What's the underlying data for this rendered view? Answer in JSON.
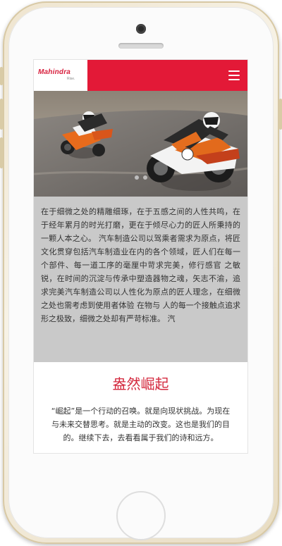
{
  "brand": {
    "name": "Mahindra",
    "sub": "Rise.",
    "accent": "#e31937",
    "title_color": "#d42a3f"
  },
  "header": {
    "menu_icon": "hamburger-menu-icon"
  },
  "hero": {
    "image": "motorcycle-racers-on-track",
    "slides": 2,
    "active_slide": 1
  },
  "intro": {
    "text": "在于细微之处的精雕细琢，在于五感之间的人性共鸣，在于经年累月的时光打磨，更在于倾尽心力的匠人所秉持的一颗人本之心。 汽车制造公司以驾乘者需求为原点，将匠文化贯穿包括汽车制造业在内的各个领域，匠人们在每一个部件、每一道工序的毫厘中苛求完美，修行感官 之敏锐，在时间的沉淀与传承中塑造器物之魂，矢志不渝，追求完美汽车制造公司以人性化为原点的匠人理念，在细微之处也需考虑到使用者体验 在物与 人的每一个接触点追求形之极致，细微之处却有严苛标准。 汽"
  },
  "section": {
    "title": "盎然崛起",
    "text": "“崛起”是一个行动的召唤。就是向现状挑战。为现在与未来交替思考。就是主动的改变。这也是我们的目的。继续下去，去看看属于我们的诗和远方。"
  }
}
